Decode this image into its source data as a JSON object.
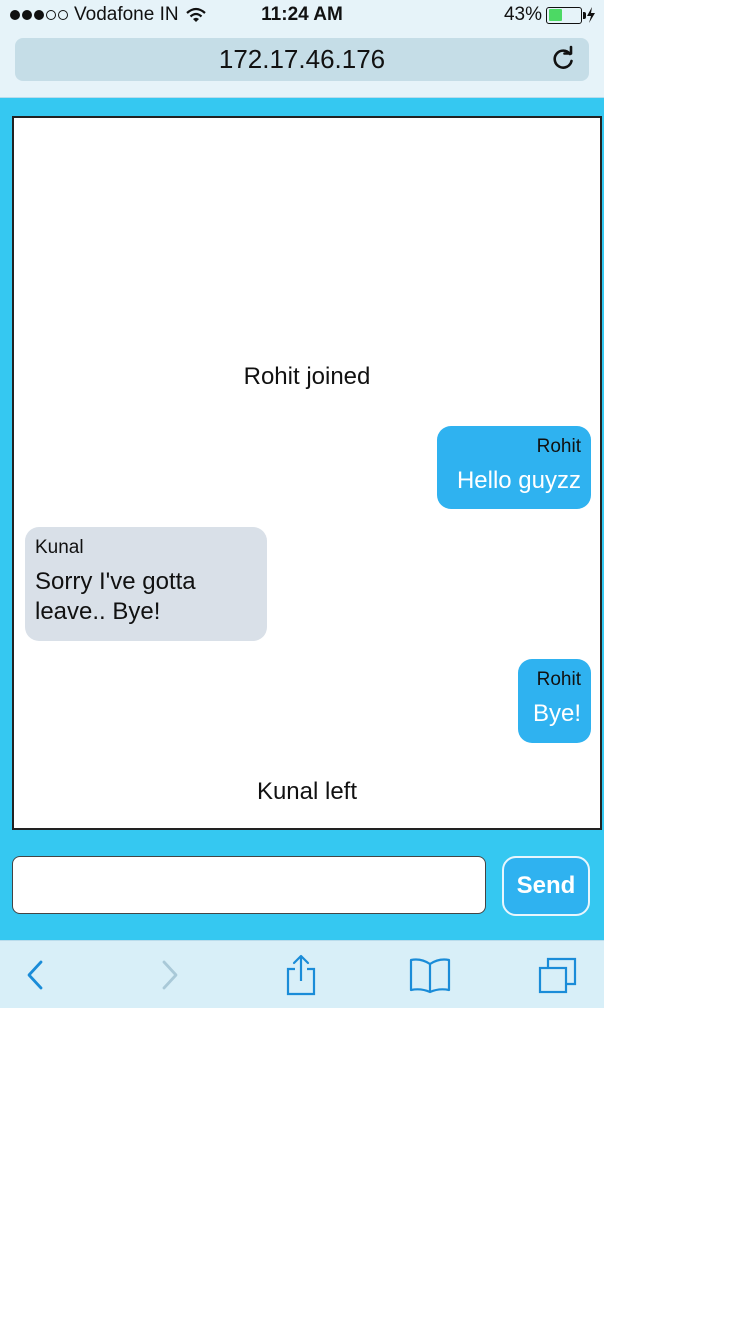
{
  "status_bar": {
    "carrier": "Vodafone IN",
    "time": "11:24 AM",
    "battery": "43%",
    "battery_level": 0.43,
    "signal_dots_full": 3,
    "signal_dots_total": 5
  },
  "browser": {
    "url": "172.17.46.176"
  },
  "chat": {
    "events": {
      "joined": "Rohit joined",
      "left": "Kunal left"
    },
    "messages": [
      {
        "sender": "Rohit",
        "text": "Hello guyzz",
        "direction": "outgoing"
      },
      {
        "sender": "Kunal",
        "text": "Sorry I've gotta leave.. Bye!",
        "direction": "incoming"
      },
      {
        "sender": "Rohit",
        "text": "Bye!",
        "direction": "outgoing"
      }
    ]
  },
  "composer": {
    "value": "",
    "send_label": "Send"
  },
  "colors": {
    "page_background": "#35c8f1",
    "outgoing_bubble": "#2fb2f0",
    "incoming_bubble": "#d9e0e8",
    "toolbar_icon": "#1a8cd8"
  },
  "toolbar": {
    "icons": [
      "back-icon",
      "forward-icon",
      "share-icon",
      "bookmarks-icon",
      "tabs-icon"
    ]
  }
}
